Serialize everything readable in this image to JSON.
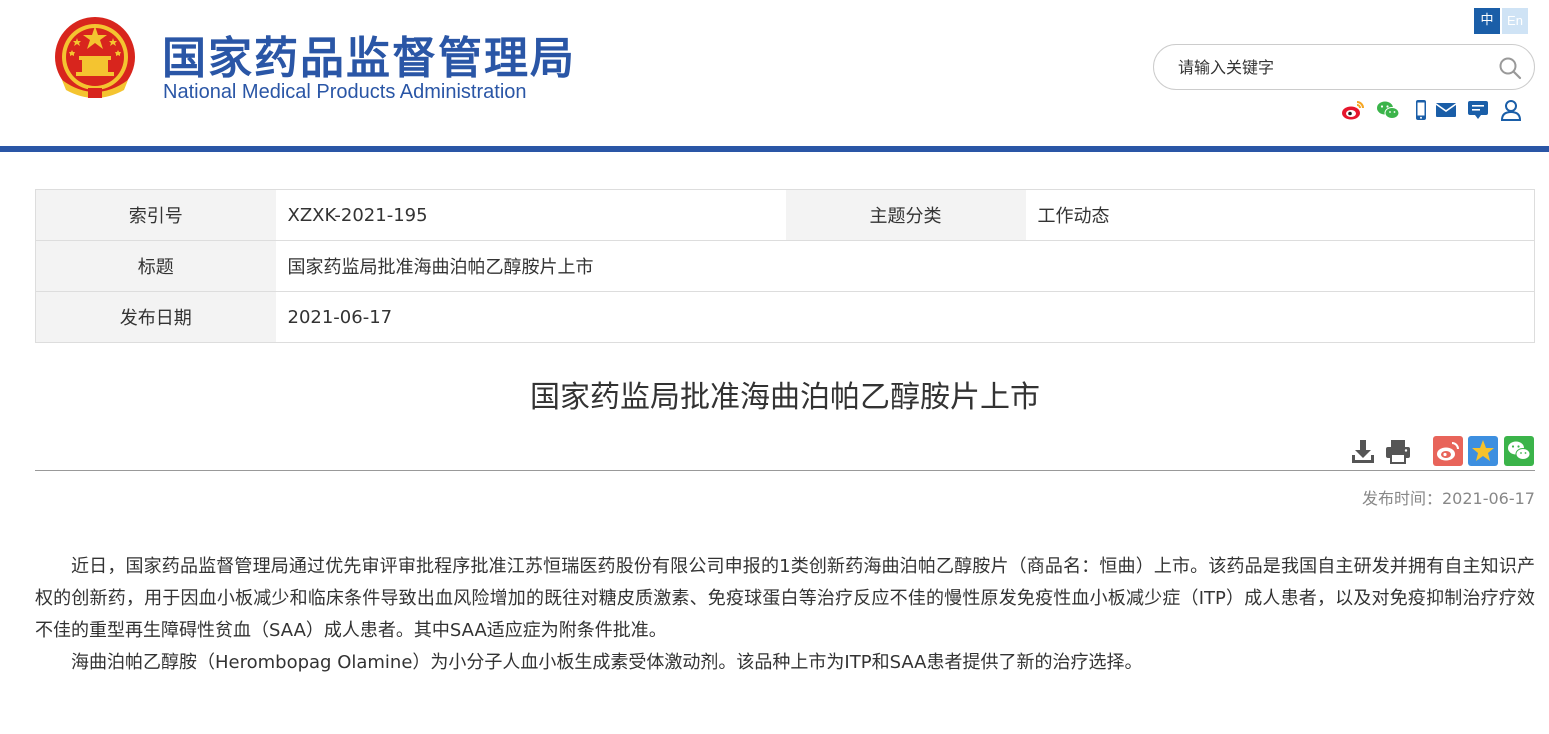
{
  "header": {
    "title_cn": "国家药品监督管理局",
    "title_en": "National Medical Products Administration",
    "lang_zh": "中",
    "lang_en": "En",
    "search_placeholder": "请输入关键字",
    "icons": [
      "weibo-icon",
      "wechat-icon",
      "mobile-icon",
      "mail-icon",
      "comment-icon",
      "user-icon"
    ]
  },
  "info": {
    "index_label": "索引号",
    "index_value": "XZXK-2021-195",
    "category_label": "主题分类",
    "category_value": "工作动态",
    "title_label": "标题",
    "title_value": "国家药监局批准海曲泊帕乙醇胺片上市",
    "date_label": "发布日期",
    "date_value": "2021-06-17"
  },
  "article": {
    "title": "国家药监局批准海曲泊帕乙醇胺片上市",
    "publish_time": "发布时间：2021-06-17",
    "paragraphs": [
      "近日，国家药品监督管理局通过优先审评审批程序批准江苏恒瑞医药股份有限公司申报的1类创新药海曲泊帕乙醇胺片（商品名：恒曲）上市。该药品是我国自主研发并拥有自主知识产权的创新药，用于因血小板减少和临床条件导致出血风险增加的既往对糖皮质激素、免疫球蛋白等治疗反应不佳的慢性原发免疫性血小板减少症（ITP）成人患者，以及对免疫抑制治疗疗效不佳的重型再生障碍性贫血（SAA）成人患者。其中SAA适应症为附条件批准。",
      "海曲泊帕乙醇胺（Herombopag Olamine）为小分子人血小板生成素受体激动剂。该品种上市为ITP和SAA患者提供了新的治疗选择。"
    ]
  },
  "colors": {
    "brand_blue": "#2a56a6",
    "weibo_red": "#e6162d",
    "wechat_green": "#3bb44a"
  }
}
